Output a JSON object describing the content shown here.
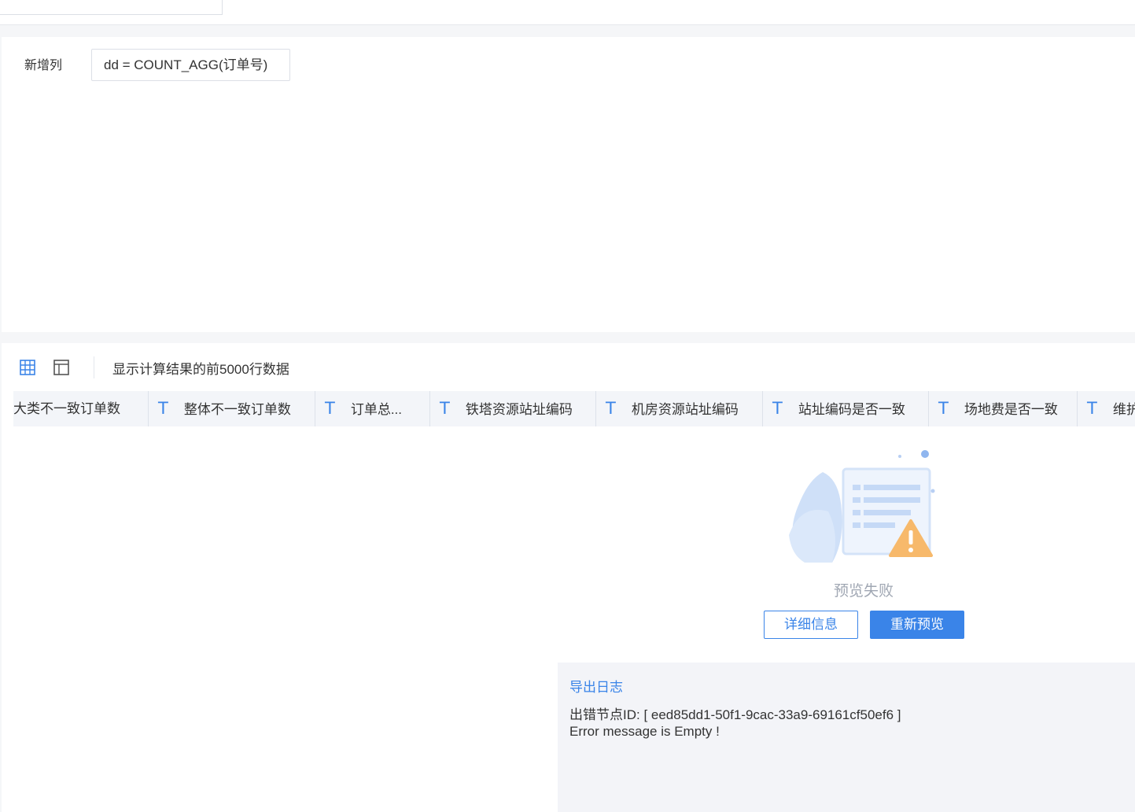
{
  "config": {
    "label": "新增列",
    "formula": "dd = COUNT_AGG(订单号)"
  },
  "toolbar": {
    "grid_icon": "grid-view-icon",
    "layout_icon": "panel-layout-icon",
    "info": "显示计算结果的前5000行数据"
  },
  "columns": [
    {
      "type": "",
      "label": "大类不一致订单数"
    },
    {
      "type": "T",
      "label": "整体不一致订单数"
    },
    {
      "type": "T",
      "label": "订单总..."
    },
    {
      "type": "T",
      "label": "铁塔资源站址编码"
    },
    {
      "type": "T",
      "label": "机房资源站址编码"
    },
    {
      "type": "T",
      "label": "站址编码是否一致"
    },
    {
      "type": "T",
      "label": "场地费是否一致"
    },
    {
      "type": "T",
      "label": "维护"
    }
  ],
  "empty": {
    "icon": "document-warning-illustration",
    "title": "预览失败",
    "detail_label": "详细信息",
    "retry_label": "重新预览"
  },
  "log": {
    "title": "导出日志",
    "line1": "出错节点ID: [ eed85dd1-50f1-9cac-33a9-69161cf50ef6 ]",
    "line2": "Error message is Empty !"
  },
  "colors": {
    "accent": "#3a84e8",
    "header_bg": "#f3f5f9",
    "log_bg": "#f3f4f8"
  }
}
